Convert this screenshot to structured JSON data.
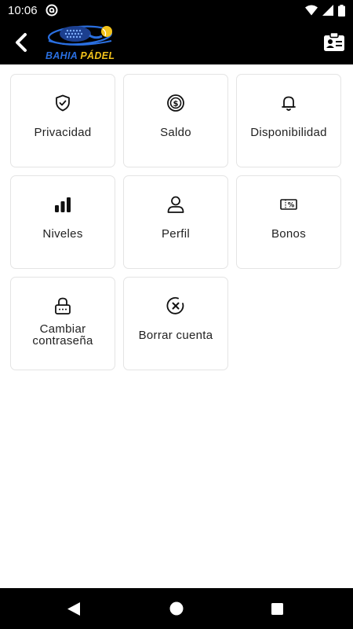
{
  "status_bar": {
    "time": "10:06",
    "icons": [
      "at-sign-icon",
      "wifi-icon",
      "signal-icon",
      "battery-icon"
    ]
  },
  "header": {
    "logo_text_primary": "BAHIA ",
    "logo_text_secondary": "PÁDEL",
    "logo_colors": {
      "blue": "#2a6fe0",
      "yellow": "#f2c21b"
    },
    "back_icon": "chevron-left-icon",
    "action_icon": "contact-card-icon"
  },
  "menu": {
    "items": [
      {
        "label": "Privacidad",
        "icon": "shield-check-icon"
      },
      {
        "label": "Saldo",
        "icon": "coin-dollar-icon"
      },
      {
        "label": "Disponibilidad",
        "icon": "bell-icon"
      },
      {
        "label": "Niveles",
        "icon": "bar-chart-icon"
      },
      {
        "label": "Perfil",
        "icon": "user-icon"
      },
      {
        "label": "Bonos",
        "icon": "ticket-percent-icon"
      },
      {
        "label": "Cambiar contraseña",
        "icon": "lock-password-icon"
      },
      {
        "label": "Borrar cuenta",
        "icon": "close-circle-icon"
      }
    ]
  },
  "nav_bar": {
    "icons": [
      "nav-back-icon",
      "nav-home-icon",
      "nav-recents-icon"
    ]
  }
}
